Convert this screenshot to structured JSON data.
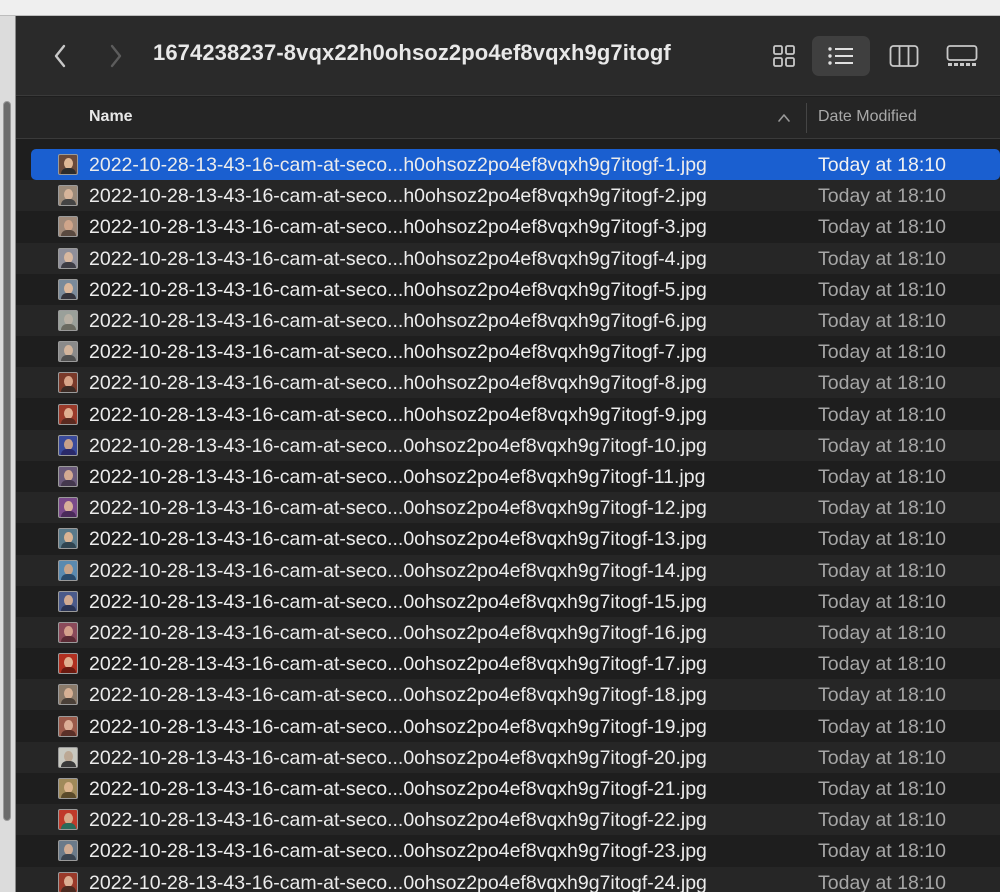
{
  "window": {
    "folder_title": "1674238237-8vqx22h0ohsoz2po4ef8vqxh9g7itogf"
  },
  "toolbar": {
    "buttons": [
      {
        "name": "back",
        "icon": "chevron-left-icon"
      },
      {
        "name": "forward",
        "icon": "chevron-right-icon"
      },
      {
        "name": "icon-view",
        "icon": "grid-icon"
      },
      {
        "name": "list-view",
        "icon": "list-icon",
        "selected": true
      },
      {
        "name": "column-view",
        "icon": "columns-icon"
      },
      {
        "name": "gallery-view",
        "icon": "gallery-icon"
      }
    ]
  },
  "columns": {
    "name": "Name",
    "date_modified": "Date Modified",
    "sort_direction": "ascending"
  },
  "colors": {
    "selection": "#1a5fd0",
    "background": "#1e1e1e",
    "alt_row": "#262626"
  },
  "files": [
    {
      "name": "2022-10-28-13-43-16-cam-at-seco...h0ohsoz2po4ef8vqxh9g7itogf-1.jpg",
      "date": "Today at 18:10",
      "selected": true,
      "thumb": [
        "#6b4a3a",
        "#e0b896",
        "#2c2c2c"
      ]
    },
    {
      "name": "2022-10-28-13-43-16-cam-at-seco...h0ohsoz2po4ef8vqxh9g7itogf-2.jpg",
      "date": "Today at 18:10",
      "thumb": [
        "#9a8a7a",
        "#d6b49a",
        "#444444"
      ]
    },
    {
      "name": "2022-10-28-13-43-16-cam-at-seco...h0ohsoz2po4ef8vqxh9g7itogf-3.jpg",
      "date": "Today at 18:10",
      "thumb": [
        "#a08a7a",
        "#cfa58a",
        "#5a4a40"
      ]
    },
    {
      "name": "2022-10-28-13-43-16-cam-at-seco...h0ohsoz2po4ef8vqxh9g7itogf-4.jpg",
      "date": "Today at 18:10",
      "thumb": [
        "#8f8f9a",
        "#d8b8a0",
        "#3c3c44"
      ]
    },
    {
      "name": "2022-10-28-13-43-16-cam-at-seco...h0ohsoz2po4ef8vqxh9g7itogf-5.jpg",
      "date": "Today at 18:10",
      "thumb": [
        "#7a8a9a",
        "#dcb89c",
        "#34343c"
      ]
    },
    {
      "name": "2022-10-28-13-43-16-cam-at-seco...h0ohsoz2po4ef8vqxh9g7itogf-6.jpg",
      "date": "Today at 18:10",
      "thumb": [
        "#9aa09a",
        "#b8b0a4",
        "#6a6a60"
      ]
    },
    {
      "name": "2022-10-28-13-43-16-cam-at-seco...h0ohsoz2po4ef8vqxh9g7itogf-7.jpg",
      "date": "Today at 18:10",
      "thumb": [
        "#8a8a8a",
        "#d2b49c",
        "#505050"
      ]
    },
    {
      "name": "2022-10-28-13-43-16-cam-at-seco...h0ohsoz2po4ef8vqxh9g7itogf-8.jpg",
      "date": "Today at 18:10",
      "thumb": [
        "#7a3a2a",
        "#d8a488",
        "#3a2a24"
      ]
    },
    {
      "name": "2022-10-28-13-43-16-cam-at-seco...h0ohsoz2po4ef8vqxh9g7itogf-9.jpg",
      "date": "Today at 18:10",
      "thumb": [
        "#9a3a2a",
        "#e0ae90",
        "#5a2a20"
      ]
    },
    {
      "name": "2022-10-28-13-43-16-cam-at-seco...0ohsoz2po4ef8vqxh9g7itogf-10.jpg",
      "date": "Today at 18:10",
      "thumb": [
        "#3a4a9a",
        "#c8a08a",
        "#2a2a6a"
      ]
    },
    {
      "name": "2022-10-28-13-43-16-cam-at-seco...0ohsoz2po4ef8vqxh9g7itogf-11.jpg",
      "date": "Today at 18:10",
      "thumb": [
        "#6a5a7a",
        "#d4aa92",
        "#44384e"
      ]
    },
    {
      "name": "2022-10-28-13-43-16-cam-at-seco...0ohsoz2po4ef8vqxh9g7itogf-12.jpg",
      "date": "Today at 18:10",
      "thumb": [
        "#7a4a8a",
        "#d8b09a",
        "#4a2a5a"
      ]
    },
    {
      "name": "2022-10-28-13-43-16-cam-at-seco...0ohsoz2po4ef8vqxh9g7itogf-13.jpg",
      "date": "Today at 18:10",
      "thumb": [
        "#5a7a8a",
        "#dab494",
        "#304450"
      ]
    },
    {
      "name": "2022-10-28-13-43-16-cam-at-seco...0ohsoz2po4ef8vqxh9g7itogf-14.jpg",
      "date": "Today at 18:10",
      "thumb": [
        "#5a8ab0",
        "#c8a48a",
        "#2a4a6a"
      ]
    },
    {
      "name": "2022-10-28-13-43-16-cam-at-seco...0ohsoz2po4ef8vqxh9g7itogf-15.jpg",
      "date": "Today at 18:10",
      "thumb": [
        "#4a5a8a",
        "#d0aa92",
        "#2a3454"
      ]
    },
    {
      "name": "2022-10-28-13-43-16-cam-at-seco...0ohsoz2po4ef8vqxh9g7itogf-16.jpg",
      "date": "Today at 18:10",
      "thumb": [
        "#8a4a5a",
        "#d4a08c",
        "#5a2a34"
      ]
    },
    {
      "name": "2022-10-28-13-43-16-cam-at-seco...0ohsoz2po4ef8vqxh9g7itogf-17.jpg",
      "date": "Today at 18:10",
      "thumb": [
        "#b03020",
        "#e0b090",
        "#6a1a10"
      ]
    },
    {
      "name": "2022-10-28-13-43-16-cam-at-seco...0ohsoz2po4ef8vqxh9g7itogf-18.jpg",
      "date": "Today at 18:10",
      "thumb": [
        "#8a7a6a",
        "#d6b094",
        "#4a4038"
      ]
    },
    {
      "name": "2022-10-28-13-43-16-cam-at-seco...0ohsoz2po4ef8vqxh9g7itogf-19.jpg",
      "date": "Today at 18:10",
      "thumb": [
        "#9a5a4a",
        "#dcae96",
        "#5a3028"
      ]
    },
    {
      "name": "2022-10-28-13-43-16-cam-at-seco...0ohsoz2po4ef8vqxh9g7itogf-20.jpg",
      "date": "Today at 18:10",
      "thumb": [
        "#c8c8c0",
        "#bca894",
        "#3a3a3a"
      ]
    },
    {
      "name": "2022-10-28-13-43-16-cam-at-seco...0ohsoz2po4ef8vqxh9g7itogf-21.jpg",
      "date": "Today at 18:10",
      "thumb": [
        "#a08a5a",
        "#dcb48e",
        "#5a4a2a"
      ]
    },
    {
      "name": "2022-10-28-13-43-16-cam-at-seco...0ohsoz2po4ef8vqxh9g7itogf-22.jpg",
      "date": "Today at 18:10",
      "thumb": [
        "#c03a2a",
        "#d8aa8a",
        "#2a6a5a"
      ]
    },
    {
      "name": "2022-10-28-13-43-16-cam-at-seco...0ohsoz2po4ef8vqxh9g7itogf-23.jpg",
      "date": "Today at 18:10",
      "thumb": [
        "#6a7a8a",
        "#d0ac94",
        "#3a4450"
      ]
    },
    {
      "name": "2022-10-28-13-43-16-cam-at-seco...0ohsoz2po4ef8vqxh9g7itogf-24.jpg",
      "date": "Today at 18:10",
      "thumb": [
        "#9a3a2a",
        "#dcae92",
        "#4a2a20"
      ]
    }
  ]
}
